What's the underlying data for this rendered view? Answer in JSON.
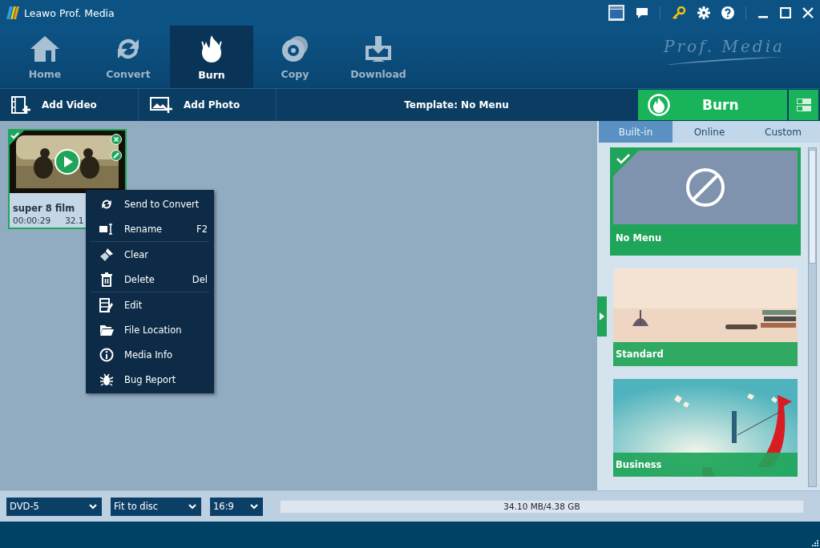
{
  "window": {
    "title": "Leawo Prof. Media"
  },
  "nav": {
    "tabs": [
      {
        "label": "Home",
        "selected": false
      },
      {
        "label": "Convert",
        "selected": false
      },
      {
        "label": "Burn",
        "selected": true
      },
      {
        "label": "Copy",
        "selected": false
      },
      {
        "label": "Download",
        "selected": false
      }
    ],
    "logo_text": "Prof. Media"
  },
  "toolbar": {
    "add_video": "Add Video",
    "add_photo": "Add Photo",
    "template": "Template: No Menu",
    "burn_button": "Burn"
  },
  "media": [
    {
      "title": "super 8 film",
      "duration": "00:00:29",
      "size": "32.1",
      "selected": true
    }
  ],
  "context_menu": {
    "groups": [
      [
        {
          "label": "Send to Convert"
        },
        {
          "label": "Rename",
          "shortcut": "F2"
        }
      ],
      [
        {
          "label": "Clear"
        },
        {
          "label": "Delete",
          "shortcut": "Del"
        }
      ],
      [
        {
          "label": "Edit"
        },
        {
          "label": "File Location"
        },
        {
          "label": "Media Info"
        },
        {
          "label": "Bug Report"
        }
      ]
    ]
  },
  "templates": {
    "tabs": [
      {
        "label": "Built-in",
        "selected": true
      },
      {
        "label": "Online",
        "selected": false
      },
      {
        "label": "Custom",
        "selected": false
      }
    ],
    "items": [
      {
        "name": "No Menu",
        "kind": "none",
        "selected": true
      },
      {
        "name": "Standard",
        "kind": "picture",
        "selected": false
      },
      {
        "name": "Business",
        "kind": "picture",
        "selected": false
      }
    ]
  },
  "bottom": {
    "disc_type": "DVD-5",
    "fit": "Fit to disc",
    "aspect": "16:9",
    "usage": "34.10 MB/4.38 GB"
  }
}
